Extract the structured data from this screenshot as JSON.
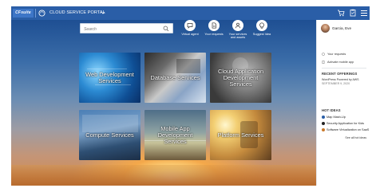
{
  "header": {
    "brand": "CFsuite",
    "portal_title": "CLOUD SERVICE PORTAL",
    "icons": [
      "portal-icon",
      "chevron-down-icon",
      "cart-icon",
      "clipboard-icon",
      "hamburger-icon"
    ]
  },
  "search": {
    "placeholder": "Search"
  },
  "quick_actions": [
    {
      "label": "Virtual agent",
      "icon": "chat-icon"
    },
    {
      "label": "Your requests",
      "icon": "document-icon"
    },
    {
      "label": "Your services and assets",
      "icon": "people-icon"
    },
    {
      "label": "Suggest Idea",
      "icon": "lightbulb-icon"
    }
  ],
  "tiles": [
    {
      "label": "Web Development Services"
    },
    {
      "label": "Database Services"
    },
    {
      "label": "Cloud Application Development Services"
    },
    {
      "label": "Compute Services"
    },
    {
      "label": "Mobile App Development Services"
    },
    {
      "label": "Platform Services"
    }
  ],
  "panel": {
    "user_name": "Garcia, Eve",
    "links": [
      "Your requests",
      "Activate mobile app"
    ],
    "recent_heading": "RECENT OFFERINGS",
    "recent_item": "WordPress Powered by AWS",
    "recent_date": "SEPTEMBER 9, 2020",
    "hot_heading": "HOT IDEAS",
    "hot_ideas": [
      {
        "label": "Map Mash-Up",
        "color": "#2a5ea7"
      },
      {
        "label": "Security Application for Kids",
        "color": "#222222"
      },
      {
        "label": "Software Virtualization on SaaS",
        "color": "#c9792b"
      }
    ],
    "see_all": "See all hot ideas"
  },
  "colors": {
    "topbar": "#2a5ea7",
    "brand": "#3d76c7"
  }
}
